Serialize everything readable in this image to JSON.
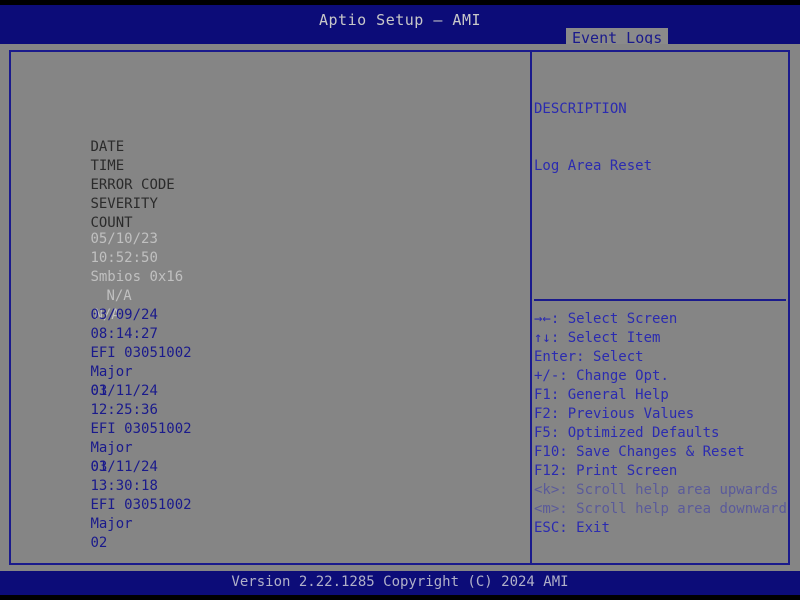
{
  "header": {
    "title": "Aptio Setup – AMI",
    "tabs": [
      {
        "label": "Event Logs",
        "selected": true
      }
    ]
  },
  "event_log": {
    "columns": [
      "DATE",
      "TIME",
      "ERROR CODE",
      "SEVERITY",
      "COUNT"
    ],
    "rows": [
      {
        "date": "05/10/23",
        "time": "10:52:50",
        "error_code": "Smbios 0x16",
        "severity": "N/A",
        "count": "N/A",
        "dimmed": true
      },
      {
        "date": "03/09/24",
        "time": "08:14:27",
        "error_code": "EFI 03051002",
        "severity": "Major",
        "count": "01",
        "dimmed": false
      },
      {
        "date": "03/11/24",
        "time": "12:25:36",
        "error_code": "EFI 03051002",
        "severity": "Major",
        "count": "01",
        "dimmed": false
      },
      {
        "date": "03/11/24",
        "time": "13:30:18",
        "error_code": "EFI 03051002",
        "severity": "Major",
        "count": "02",
        "dimmed": false
      }
    ]
  },
  "description": {
    "heading": "DESCRIPTION",
    "text": "Log Area Reset"
  },
  "help": {
    "keys": [
      {
        "glyph": "→←",
        "icon": "left-right-arrow-icon",
        "label": ": Select Screen",
        "dim": false
      },
      {
        "glyph": "↑↓",
        "icon": "up-down-arrow-icon",
        "label": ": Select Item",
        "dim": false
      },
      {
        "glyph": "Enter",
        "icon": "enter-key-icon",
        "label": ": Select",
        "dim": false
      },
      {
        "glyph": "+/-",
        "icon": "plus-minus-key-icon",
        "label": ": Change Opt.",
        "dim": false
      },
      {
        "glyph": "F1",
        "icon": "f1-key-icon",
        "label": ": General Help",
        "dim": false
      },
      {
        "glyph": "F2",
        "icon": "f2-key-icon",
        "label": ": Previous Values",
        "dim": false
      },
      {
        "glyph": "F5",
        "icon": "f5-key-icon",
        "label": ": Optimized Defaults",
        "dim": false
      },
      {
        "glyph": "F10",
        "icon": "f10-key-icon",
        "label": ": Save Changes & Reset",
        "dim": false
      },
      {
        "glyph": "F12",
        "icon": "f12-key-icon",
        "label": ": Print Screen",
        "dim": false
      },
      {
        "glyph": "<k>",
        "icon": "k-key-icon",
        "label": ": Scroll help area upwards",
        "dim": true
      },
      {
        "glyph": "<m>",
        "icon": "m-key-icon",
        "label": ": Scroll help area downwards",
        "dim": true
      },
      {
        "glyph": "ESC",
        "icon": "esc-key-icon",
        "label": ": Exit",
        "dim": false
      }
    ]
  },
  "footer": {
    "version_text": "Version 2.22.1285 Copyright (C) 2024 AMI"
  },
  "colors": {
    "header_blue": "#0c0c78",
    "body_grey": "#858585",
    "text_blue": "#2b2bb0",
    "border_blue": "#1a1a8c",
    "dim_grey": "#c0c0c0"
  }
}
